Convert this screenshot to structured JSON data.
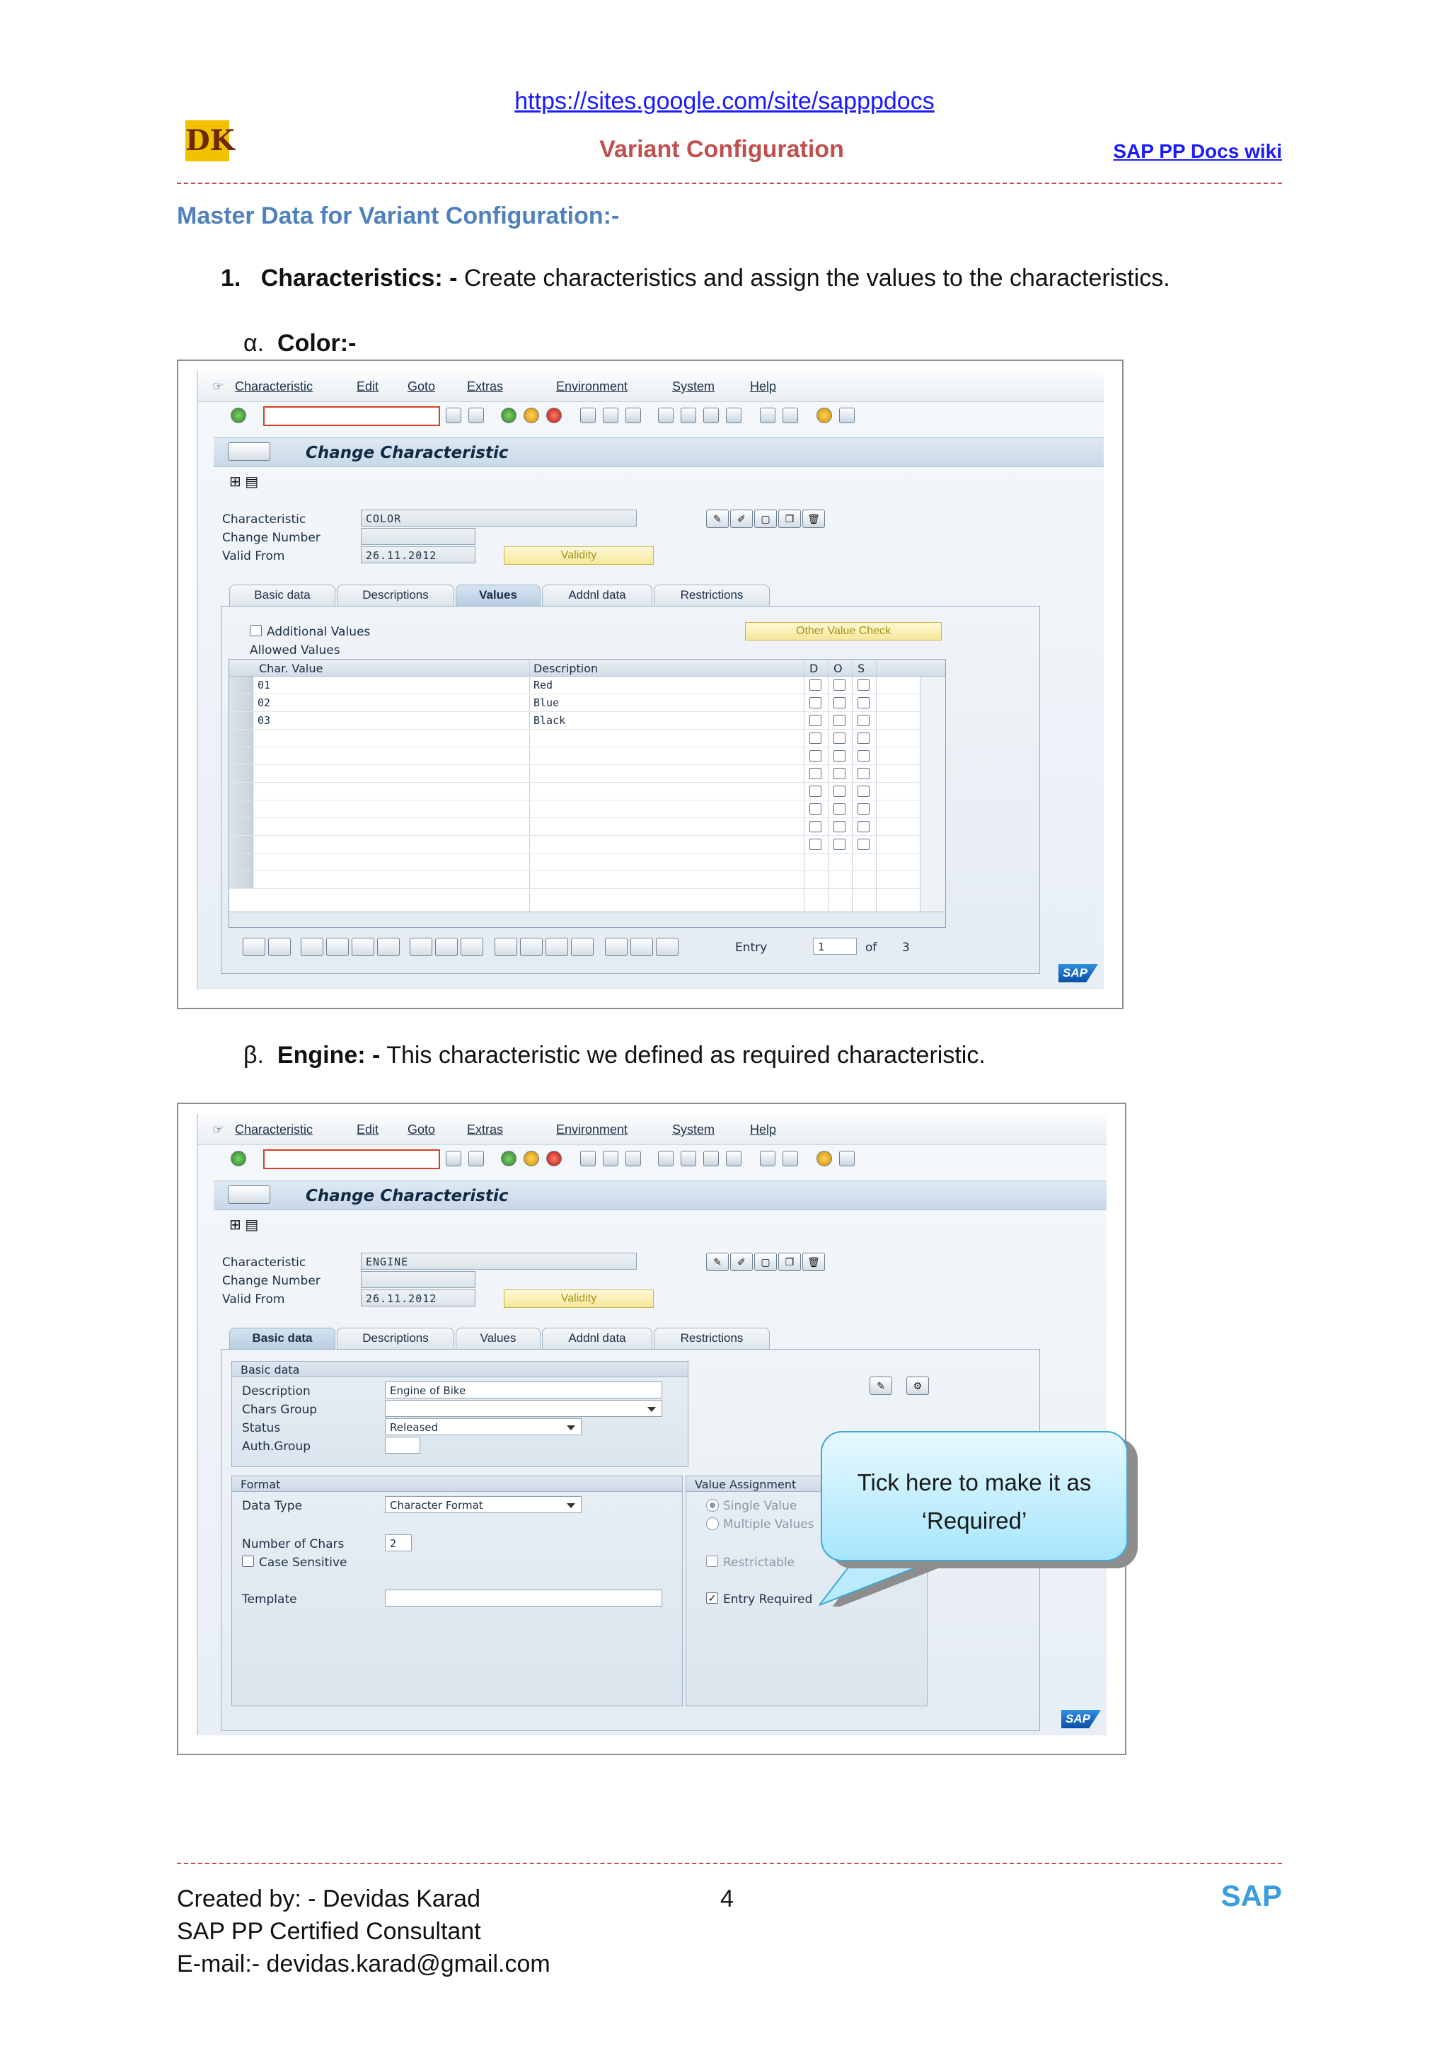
{
  "header": {
    "url": "https://sites.google.com/site/sapppdocs",
    "logo_text": "DK",
    "title": "Variant Configuration",
    "wiki_link": "SAP PP Docs wiki"
  },
  "section_heading": "Master Data for Variant Configuration:-",
  "item1": {
    "number": "1.",
    "bold": "Characteristics: -",
    "text": " Create characteristics and assign the values to the characteristics."
  },
  "alpha": {
    "symbol": "α.",
    "bold": "Color:-"
  },
  "beta": {
    "symbol": "β.",
    "bold": "Engine: -",
    "text": " This characteristic we defined as required characteristic."
  },
  "sap_menu": [
    "Characteristic",
    "Edit",
    "Goto",
    "Extras",
    "Environment",
    "System",
    "Help"
  ],
  "screen1": {
    "title": "Change Characteristic",
    "labels": {
      "characteristic": "Characteristic",
      "change_number": "Change Number",
      "valid_from": "Valid From"
    },
    "characteristic": "COLOR",
    "valid_from": "26.11.2012",
    "validity_btn": "Validity",
    "tabs": [
      "Basic data",
      "Descriptions",
      "Values",
      "Addnl data",
      "Restrictions"
    ],
    "active_tab": 2,
    "additional_values": "Additional Values",
    "other_value_check": "Other Value Check",
    "allowed_values": "Allowed Values",
    "columns": [
      "Char. Value",
      "Description",
      "D",
      "O",
      "S"
    ],
    "rows": [
      {
        "value": "01",
        "desc": "Red"
      },
      {
        "value": "02",
        "desc": "Blue"
      },
      {
        "value": "03",
        "desc": "Black"
      }
    ],
    "entry_label": "Entry",
    "entry_value": "1",
    "of_label": "of",
    "total": "3",
    "sap_logo": "SAP"
  },
  "screen2": {
    "title": "Change Characteristic",
    "labels": {
      "characteristic": "Characteristic",
      "change_number": "Change Number",
      "valid_from": "Valid From"
    },
    "characteristic": "ENGINE",
    "valid_from": "26.11.2012",
    "validity_btn": "Validity",
    "tabs": [
      "Basic data",
      "Descriptions",
      "Values",
      "Addnl data",
      "Restrictions"
    ],
    "active_tab": 0,
    "basic_group": "Basic data",
    "description_label": "Description",
    "description_value": "Engine of Bike",
    "chars_group_label": "Chars Group",
    "status_label": "Status",
    "status_value": "Released",
    "auth_group_label": "Auth.Group",
    "format_group": "Format",
    "data_type_label": "Data Type",
    "data_type_value": "Character Format",
    "num_chars_label": "Number of Chars",
    "num_chars_value": "2",
    "case_sensitive": "Case Sensitive",
    "template_label": "Template",
    "value_assignment": "Value Assignment",
    "single_value": "Single Value",
    "multiple_values": "Multiple Values",
    "restrictable": "Restrictable",
    "entry_required": "Entry Required",
    "sap_logo": "SAP"
  },
  "callout": {
    "line1": "Tick here to make it as",
    "line2": "‘Required’"
  },
  "footer": {
    "created_by": "Created by: - Devidas Karad",
    "role": "SAP PP Certified Consultant",
    "email": "E-mail:- devidas.karad@gmail.com",
    "page": "4",
    "brand": "SAP"
  }
}
